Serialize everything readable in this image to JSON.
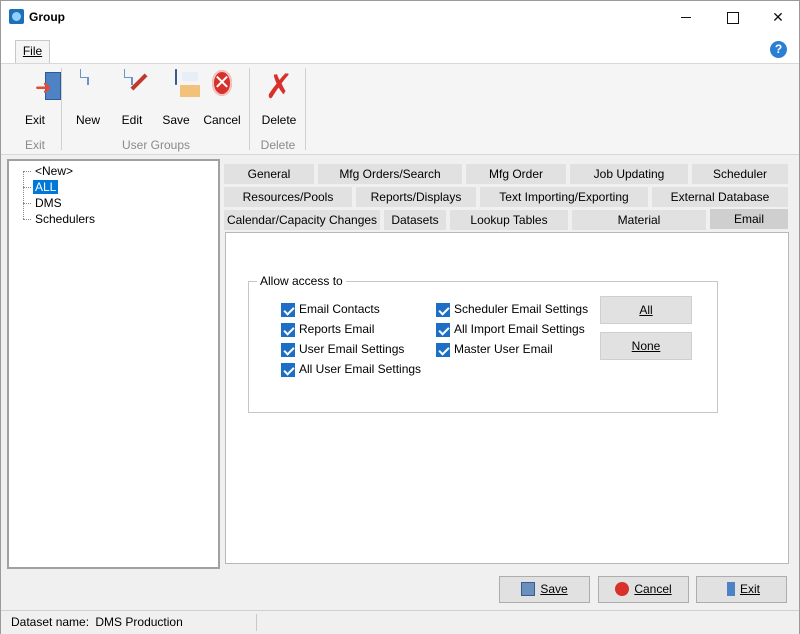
{
  "window": {
    "title": "Group"
  },
  "ribbon": {
    "file_tab": "File",
    "buttons": {
      "exit": "Exit",
      "new": "New",
      "edit": "Edit",
      "save": "Save",
      "cancel": "Cancel",
      "delete": "Delete"
    },
    "groups": {
      "exit": "Exit",
      "user_groups": "User Groups",
      "delete": "Delete"
    }
  },
  "tree": {
    "items": [
      "<New>",
      "ALL",
      "DMS",
      "Schedulers"
    ],
    "selected": "ALL"
  },
  "tabs": {
    "row1": [
      "General",
      "Mfg Orders/Search",
      "Mfg Order",
      "Job Updating",
      "Scheduler"
    ],
    "row2": [
      "Resources/Pools",
      "Reports/Displays",
      "Text Importing/Exporting",
      "External Database"
    ],
    "row3": [
      "Calendar/Capacity Changes",
      "Datasets",
      "Lookup Tables",
      "Material",
      "Email"
    ],
    "active": "Email"
  },
  "email_panel": {
    "group_title": "Allow access to",
    "checkboxes": [
      {
        "label": "Email Contacts",
        "checked": true
      },
      {
        "label": "Reports Email",
        "checked": true
      },
      {
        "label": "User Email Settings",
        "checked": true
      },
      {
        "label": "All User Email Settings",
        "checked": true
      },
      {
        "label": "Scheduler Email Settings",
        "checked": true
      },
      {
        "label": "All Import Email Settings",
        "checked": true
      },
      {
        "label": "Master User Email",
        "checked": true
      }
    ],
    "all_button": "All",
    "none_button": "None"
  },
  "footer": {
    "save": "Save",
    "cancel": "Cancel",
    "exit": "Exit"
  },
  "status": {
    "dataset_label": "Dataset name:",
    "dataset_value": "DMS Production"
  },
  "colors": {
    "accent": "#0078d7",
    "checkbox": "#1c6fc4",
    "danger": "#d8302b"
  }
}
